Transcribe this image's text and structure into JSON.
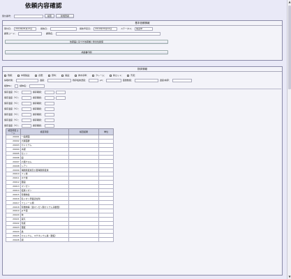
{
  "page": {
    "title": "依頼内容確認"
  },
  "topbar": {
    "label": "受付番号：",
    "search_btn": "検索",
    "new_btn": "新規登録"
  },
  "basic": {
    "header": "基本依頼情報",
    "fields": [
      {
        "label": "受付日：",
        "value": "2019年05月17日"
      },
      {
        "label": "報告日：",
        "value": ""
      },
      {
        "label": "報告予定日：",
        "value": "2019年05月24日"
      },
      {
        "label": "ステータス：",
        "value": "検査中"
      }
    ],
    "customer_code_label": "顧客コード：",
    "customer_name_label": "顧客名：",
    "btn_confirm": "依頼届に基づき依頼書と整合性確保",
    "btn_report": "成績書印刷"
  },
  "analysis": {
    "header": "検体情報",
    "checkboxes": [
      "残留：",
      "中間製品：",
      "表層：",
      "原料：",
      "製品：",
      "排水基準：",
      "クレーム：",
      "新ロット：",
      "汚泥："
    ],
    "row2_labels": [
      "採取状態：",
      "温度：",
      "残存塩素濃度：",
      "ph：",
      "菌量数値：",
      "",
      "温度/換算："
    ],
    "row3_labels": [
      "検体No：",
      "検体名：",
      "小数点数："
    ],
    "storage_rows": [
      {
        "temp_label": "保存温度（℃）：",
        "period_label": "保存期間："
      },
      {
        "temp_label": "保存温度（℃）：",
        "period_label": "保存期間："
      },
      {
        "temp_label": "保存温度（℃）：",
        "period_label": "保存期間："
      },
      {
        "temp_label": "保存温度（℃）：",
        "period_label": "保存期間："
      },
      {
        "temp_label": "保存温度（℃）：",
        "period_label": "保存期間："
      },
      {
        "temp_label": "保存温度（℃）：",
        "period_label": "保存期間："
      },
      {
        "temp_label": "保存温度（℃）：",
        "period_label": "保存期間："
      }
    ]
  },
  "table": {
    "headers": [
      "検査項目コード",
      "検査項目",
      "検査結果",
      "単位"
    ],
    "rows": [
      {
        "code": "29001",
        "name": "一般細菌"
      },
      {
        "code": "29002",
        "name": "大腸菌群"
      },
      {
        "code": "29003",
        "name": "カドミウム"
      },
      {
        "code": "29004",
        "name": "水銀"
      },
      {
        "code": "29005",
        "name": "セレン"
      },
      {
        "code": "29006",
        "name": "鉛"
      },
      {
        "code": "29007",
        "name": "六価クロム"
      },
      {
        "code": "29008",
        "name": "シアン"
      },
      {
        "code": "29009",
        "name": "硝酸態窒素及び亜硝酸態窒素"
      },
      {
        "code": "29010",
        "name": "フッ素"
      },
      {
        "code": "29011",
        "name": "ホウ素"
      },
      {
        "code": "29012",
        "name": "亜鉛"
      },
      {
        "code": "29013",
        "name": "マンガン"
      },
      {
        "code": "29014",
        "name": "塩素イオン"
      },
      {
        "code": "29015",
        "name": "有機物質"
      },
      {
        "code": "29016",
        "name": "陰イオン界面活性剤"
      },
      {
        "code": "29017",
        "name": "フェノール類"
      },
      {
        "code": "29018",
        "name": "有機物等（過マンガン酸カリウム消費量）"
      },
      {
        "code": "29019",
        "name": "ｐＨ値"
      },
      {
        "code": "29020",
        "name": "味"
      },
      {
        "code": "29021",
        "name": "臭気"
      },
      {
        "code": "29022",
        "name": "色度"
      },
      {
        "code": "29023",
        "name": "濁度"
      },
      {
        "code": "29024",
        "name": "鉄"
      },
      {
        "code": "29025",
        "name": "カルシウム、マグネシウム等（硬度）"
      },
      {
        "code": "29026",
        "name": "銅"
      }
    ]
  }
}
